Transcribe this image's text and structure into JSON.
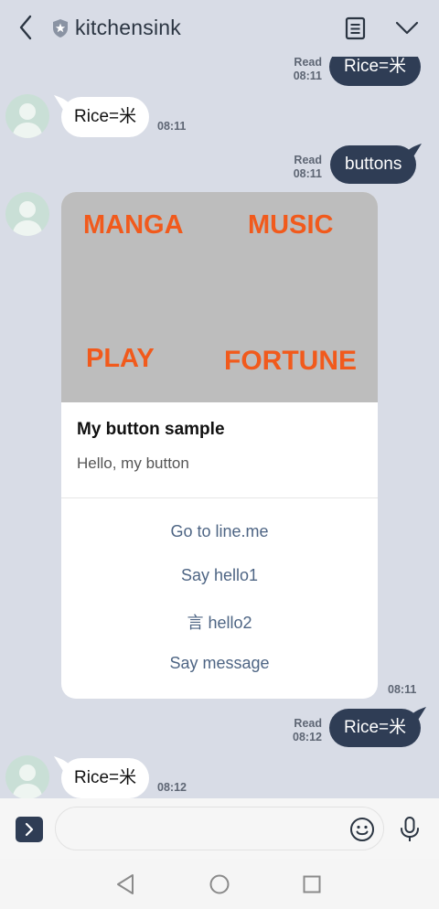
{
  "header": {
    "title": "kitchensink"
  },
  "messages": {
    "out1": {
      "text": "Rice=米",
      "read": "Read",
      "time": "08:11"
    },
    "in1": {
      "text": "Rice=米",
      "time": "08:11"
    },
    "out2": {
      "text": "buttons",
      "read": "Read",
      "time": "08:11"
    },
    "card": {
      "image_words": [
        "MANGA",
        "MUSIC",
        "PLAY",
        "FORTUNE"
      ],
      "title": "My button sample",
      "text": "Hello, my button",
      "actions": [
        "Go to line.me",
        "Say hello1",
        "言 hello2",
        "Say message"
      ],
      "time": "08:11"
    },
    "out3": {
      "text": "Rice=米",
      "read": "Read",
      "time": "08:12"
    },
    "in2": {
      "text": "Rice=米",
      "time": "08:12"
    }
  },
  "input": {
    "placeholder": ""
  },
  "icons": {
    "back": "chevron-left-icon",
    "shield": "shield-star-icon",
    "note": "note-icon",
    "menu": "chevron-down-icon",
    "expand": "chevron-right-icon",
    "emoji": "smiley-icon",
    "mic": "microphone-icon"
  },
  "colors": {
    "background": "#d8dce6",
    "outgoing_bubble": "#2f3d55",
    "incoming_bubble": "#ffffff",
    "card_image": "#bdbdbd",
    "image_text": "#f15a1c",
    "action_text": "#4e6584"
  }
}
